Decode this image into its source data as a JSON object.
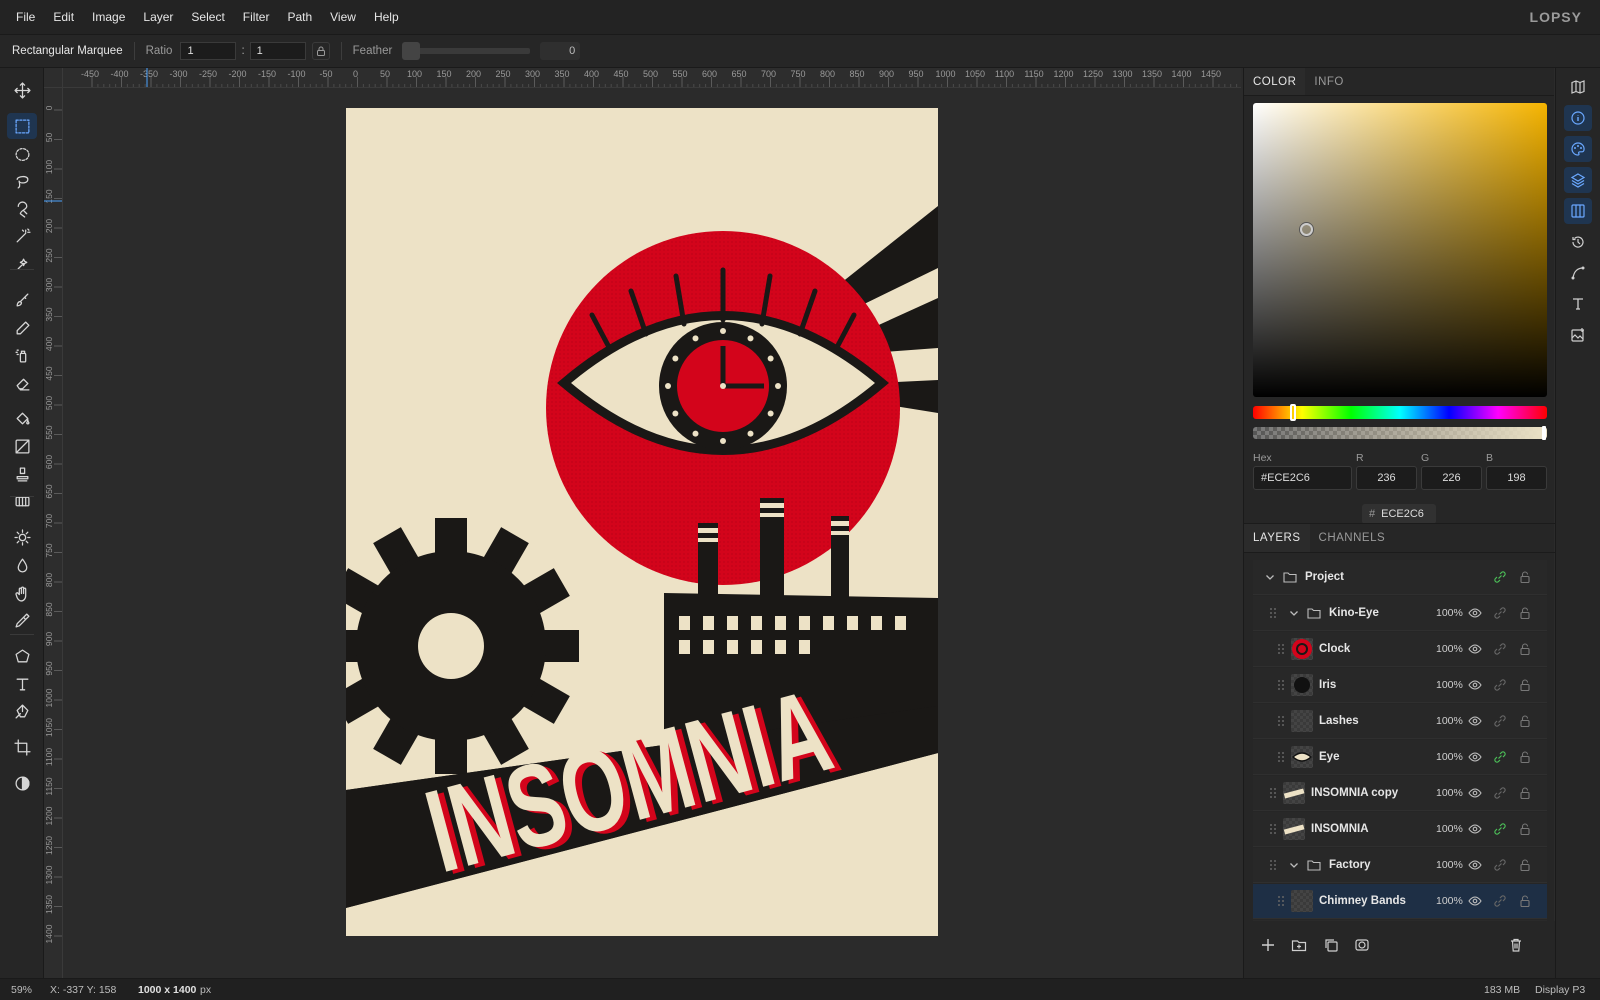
{
  "menu": [
    "File",
    "Edit",
    "Image",
    "Layer",
    "Select",
    "Filter",
    "Path",
    "View",
    "Help"
  ],
  "brand": "LOPSY",
  "options": {
    "tool_name": "Rectangular Marquee",
    "ratio_label": "Ratio",
    "ratio_w": "1",
    "ratio_h": "1",
    "ratio_sep": ":",
    "feather_label": "Feather",
    "feather_value": "0"
  },
  "ruler_top": [
    "-450",
    "-400",
    "-350",
    "-300",
    "-250",
    "-200",
    "-150",
    "-100",
    "-50",
    "0",
    "50",
    "100",
    "150",
    "200",
    "250",
    "300",
    "350",
    "400",
    "450",
    "500",
    "550",
    "600",
    "650",
    "700",
    "750",
    "800",
    "850",
    "900",
    "950",
    "1000",
    "1050",
    "1100",
    "1150",
    "1200",
    "1250",
    "1300",
    "1350",
    "1400",
    "1450"
  ],
  "ruler_left": [
    "0",
    "50",
    "100",
    "150",
    "200",
    "250",
    "300",
    "350",
    "400",
    "450",
    "500",
    "550",
    "600",
    "650",
    "700",
    "750",
    "800",
    "850",
    "900",
    "950",
    "1000",
    "1050",
    "1100",
    "1150",
    "1200",
    "1250",
    "1300",
    "1350",
    "1400"
  ],
  "tools": [
    "move-icon",
    "rectangular-marquee-icon",
    "elliptical-marquee-icon",
    "lasso-icon",
    "magnetic-lasso-icon",
    "magic-wand-icon",
    "quick-select-icon",
    "brush-icon",
    "pencil-icon",
    "spray-icon",
    "eraser-icon",
    "paint-bucket-icon",
    "gradient-icon",
    "clone-stamp-icon",
    "pattern-stamp-icon",
    "dodge-icon",
    "burn-icon",
    "hand-icon",
    "eyedropper-icon",
    "polygon-icon",
    "text-icon",
    "pen-icon",
    "crop-icon",
    "contrast-icon"
  ],
  "color_panel": {
    "tabs": [
      "COLOR",
      "INFO"
    ],
    "hex_label": "Hex",
    "r_label": "R",
    "g_label": "G",
    "b_label": "B",
    "hex": "#ECE2C6",
    "r": "236",
    "g": "226",
    "b": "198",
    "chip_hash": "#",
    "chip_value": "ECE2C6",
    "current_color": "#ece2c6"
  },
  "layers_panel": {
    "tabs": [
      "LAYERS",
      "CHANNELS"
    ],
    "layers": [
      {
        "name": "Project",
        "type": "group",
        "indent": 0,
        "opacity": "",
        "linked": true
      },
      {
        "name": "Kino-Eye",
        "type": "group",
        "indent": 1,
        "opacity": "100%",
        "linked": false
      },
      {
        "name": "Clock",
        "type": "layer",
        "indent": 2,
        "opacity": "100%",
        "linked": false,
        "thumb": "clock"
      },
      {
        "name": "Iris",
        "type": "layer",
        "indent": 2,
        "opacity": "100%",
        "linked": false,
        "thumb": "iris"
      },
      {
        "name": "Lashes",
        "type": "layer",
        "indent": 2,
        "opacity": "100%",
        "linked": false,
        "thumb": "empty"
      },
      {
        "name": "Eye",
        "type": "layer",
        "indent": 2,
        "opacity": "100%",
        "linked": true,
        "thumb": "eye"
      },
      {
        "name": "INSOMNIA copy",
        "type": "layer",
        "indent": 1,
        "opacity": "100%",
        "linked": false,
        "thumb": "text"
      },
      {
        "name": "INSOMNIA",
        "type": "layer",
        "indent": 1,
        "opacity": "100%",
        "linked": true,
        "thumb": "text"
      },
      {
        "name": "Factory",
        "type": "group",
        "indent": 1,
        "opacity": "100%",
        "linked": false
      },
      {
        "name": "Chimney Bands",
        "type": "layer",
        "indent": 2,
        "opacity": "100%",
        "linked": false,
        "thumb": "empty",
        "selected": true
      }
    ]
  },
  "artwork": {
    "title_text": "INSOMNIA",
    "bg_color": "#ede2c6",
    "red": "#d3041b",
    "black": "#1a1816"
  },
  "status": {
    "zoom": "59%",
    "coords": "X: -337  Y: 158",
    "doc_size": "1000 x 1400",
    "unit": "px",
    "memory": "183 MB",
    "profile": "Display P3"
  }
}
